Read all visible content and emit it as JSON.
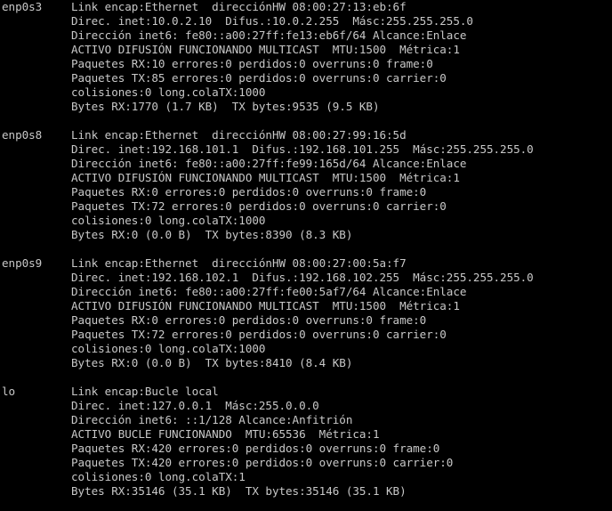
{
  "terminal": {
    "background": "#000000",
    "foreground": "#c8c8c8",
    "interfaces": [
      {
        "name": "enp0s3",
        "lines": [
          "Link encap:Ethernet  direcciónHW 08:00:27:13:eb:6f",
          "Direc. inet:10.0.2.10  Difus.:10.0.2.255  Másc:255.255.255.0",
          "Dirección inet6: fe80::a00:27ff:fe13:eb6f/64 Alcance:Enlace",
          "ACTIVO DIFUSIÓN FUNCIONANDO MULTICAST  MTU:1500  Métrica:1",
          "Paquetes RX:10 errores:0 perdidos:0 overruns:0 frame:0",
          "Paquetes TX:85 errores:0 perdidos:0 overruns:0 carrier:0",
          "colisiones:0 long.colaTX:1000",
          "Bytes RX:1770 (1.7 KB)  TX bytes:9535 (9.5 KB)"
        ]
      },
      {
        "name": "enp0s8",
        "lines": [
          "Link encap:Ethernet  direcciónHW 08:00:27:99:16:5d",
          "Direc. inet:192.168.101.1  Difus.:192.168.101.255  Másc:255.255.255.0",
          "Dirección inet6: fe80::a00:27ff:fe99:165d/64 Alcance:Enlace",
          "ACTIVO DIFUSIÓN FUNCIONANDO MULTICAST  MTU:1500  Métrica:1",
          "Paquetes RX:0 errores:0 perdidos:0 overruns:0 frame:0",
          "Paquetes TX:72 errores:0 perdidos:0 overruns:0 carrier:0",
          "colisiones:0 long.colaTX:1000",
          "Bytes RX:0 (0.0 B)  TX bytes:8390 (8.3 KB)"
        ]
      },
      {
        "name": "enp0s9",
        "lines": [
          "Link encap:Ethernet  direcciónHW 08:00:27:00:5a:f7",
          "Direc. inet:192.168.102.1  Difus.:192.168.102.255  Másc:255.255.255.0",
          "Dirección inet6: fe80::a00:27ff:fe00:5af7/64 Alcance:Enlace",
          "ACTIVO DIFUSIÓN FUNCIONANDO MULTICAST  MTU:1500  Métrica:1",
          "Paquetes RX:0 errores:0 perdidos:0 overruns:0 frame:0",
          "Paquetes TX:72 errores:0 perdidos:0 overruns:0 carrier:0",
          "colisiones:0 long.colaTX:1000",
          "Bytes RX:0 (0.0 B)  TX bytes:8410 (8.4 KB)"
        ]
      },
      {
        "name": "lo",
        "lines": [
          "Link encap:Bucle local",
          "Direc. inet:127.0.0.1  Másc:255.0.0.0",
          "Dirección inet6: ::1/128 Alcance:Anfitrión",
          "ACTIVO BUCLE FUNCIONANDO  MTU:65536  Métrica:1",
          "Paquetes RX:420 errores:0 perdidos:0 overruns:0 frame:0",
          "Paquetes TX:420 errores:0 perdidos:0 overruns:0 carrier:0",
          "colisiones:0 long.colaTX:1",
          "Bytes RX:35146 (35.1 KB)  TX bytes:35146 (35.1 KB)"
        ]
      }
    ]
  }
}
